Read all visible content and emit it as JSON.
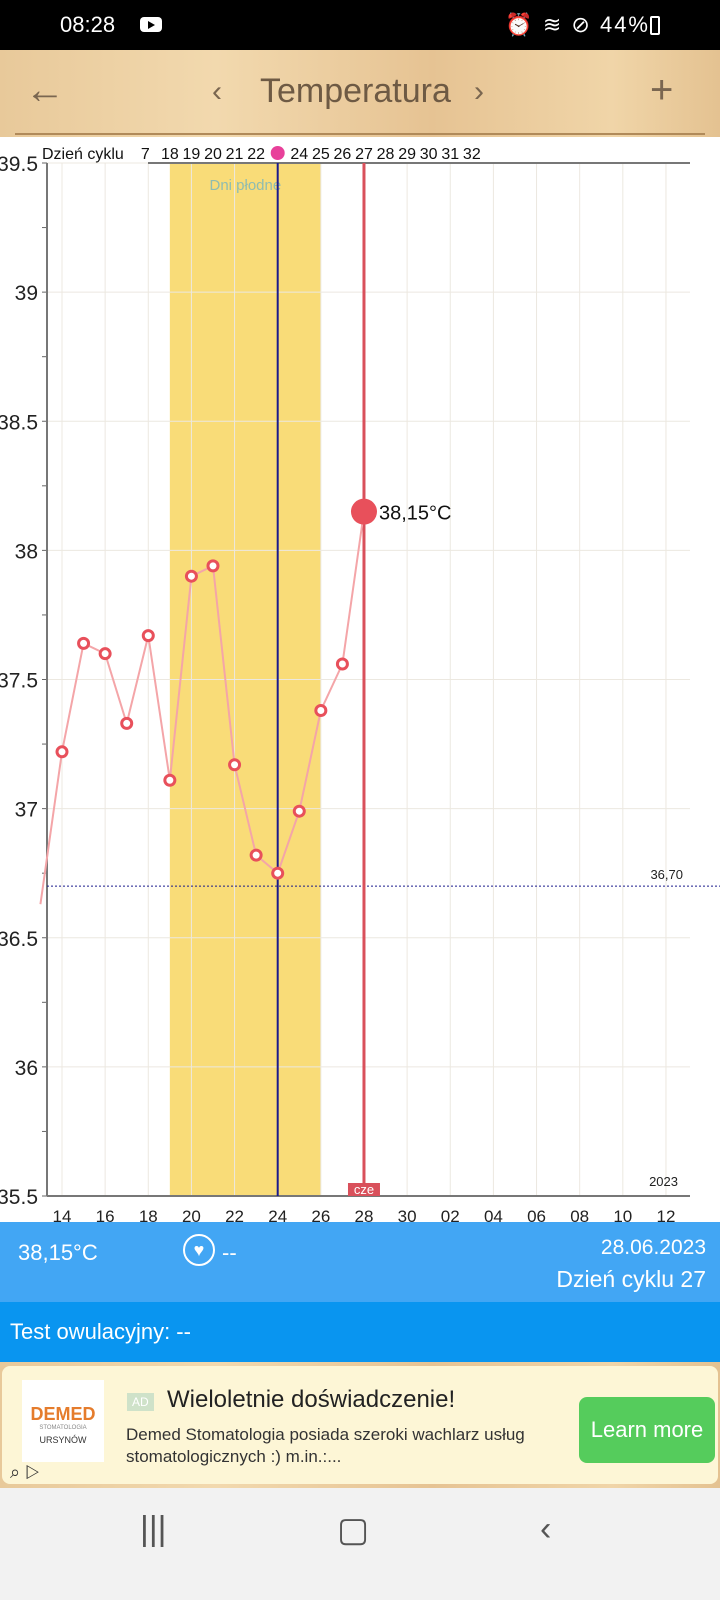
{
  "status_bar": {
    "time": "08:28",
    "battery": "44%"
  },
  "header": {
    "back_icon": "arrow-left-icon",
    "prev_icon": "chevron-left-icon",
    "title": "Temperatura",
    "next_icon": "chevron-right-icon",
    "add_icon": "plus-icon"
  },
  "chart_data": {
    "type": "line",
    "cycle_label": "Dzień cyklu",
    "cycle_days": [
      "7",
      "18",
      "19",
      "20",
      "21",
      "22",
      "",
      "24",
      "25",
      "26",
      "27",
      "28",
      "29",
      "30",
      "31",
      "32"
    ],
    "ovulation_marker_cycle_day": 23,
    "x_ticks": [
      "14",
      "16",
      "18",
      "20",
      "22",
      "24",
      "26",
      "28",
      "30",
      "02",
      "04",
      "06",
      "08",
      "10",
      "12"
    ],
    "y_ticks": [
      "39.5",
      "39",
      "38.5",
      "38",
      "37.5",
      "37",
      "36.5",
      "36",
      "35.5"
    ],
    "ylim": [
      35.5,
      39.5
    ],
    "year_label": "2023",
    "fertile_label": "Dni płodne",
    "fertile_range": [
      "19.06",
      "26.06"
    ],
    "ovulation_date": "24.06",
    "selected": {
      "date": "28.06",
      "label": "38,15°C",
      "day_label": "cze"
    },
    "reference_line": {
      "value": 36.7,
      "label": "36,70"
    },
    "points": [
      {
        "date": "13.06",
        "temp": 36.63
      },
      {
        "date": "14.06",
        "temp": 37.22
      },
      {
        "date": "15.06",
        "temp": 37.64
      },
      {
        "date": "16.06",
        "temp": 37.6
      },
      {
        "date": "17.06",
        "temp": 37.33
      },
      {
        "date": "18.06",
        "temp": 37.67
      },
      {
        "date": "19.06",
        "temp": 37.11
      },
      {
        "date": "20.06",
        "temp": 37.9
      },
      {
        "date": "21.06",
        "temp": 37.94
      },
      {
        "date": "22.06",
        "temp": 37.17
      },
      {
        "date": "23.06",
        "temp": 36.82
      },
      {
        "date": "24.06",
        "temp": 36.75
      },
      {
        "date": "25.06",
        "temp": 36.99
      },
      {
        "date": "26.06",
        "temp": 37.38
      },
      {
        "date": "27.06",
        "temp": 37.56
      },
      {
        "date": "28.06",
        "temp": 38.15
      }
    ],
    "colors": {
      "line": "#f4a5a8",
      "point": "#e8505b",
      "fertile": "#f9dc78",
      "ovulation_line": "#1a1a8c",
      "selected_line": "#d9505b"
    }
  },
  "info": {
    "temperature": "38,15°C",
    "heart_icon": "heart-icon",
    "intercourse": "--",
    "date": "28.06.2023",
    "cycle_day": "Dzień cyklu 27"
  },
  "test": {
    "label": "Test owulacyjny: --"
  },
  "ad": {
    "logo_name": "DEMED",
    "logo_sub": "STOMATOLOGIA",
    "logo_place": "URSYNÓW",
    "badge": "AD",
    "title": "Wieloletnie doświadczenie!",
    "description": "Demed Stomatologia posiada szeroki wachlarz usług stomatologicznych :) m.in.:...",
    "cta": "Learn more"
  }
}
